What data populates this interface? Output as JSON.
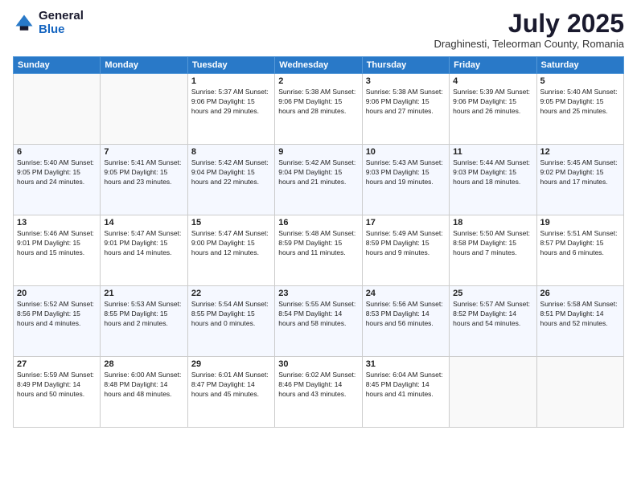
{
  "logo": {
    "general": "General",
    "blue": "Blue"
  },
  "header": {
    "month": "July 2025",
    "location": "Draghinesti, Teleorman County, Romania"
  },
  "weekdays": [
    "Sunday",
    "Monday",
    "Tuesday",
    "Wednesday",
    "Thursday",
    "Friday",
    "Saturday"
  ],
  "weeks": [
    [
      {
        "num": "",
        "detail": ""
      },
      {
        "num": "",
        "detail": ""
      },
      {
        "num": "1",
        "detail": "Sunrise: 5:37 AM\nSunset: 9:06 PM\nDaylight: 15 hours\nand 29 minutes."
      },
      {
        "num": "2",
        "detail": "Sunrise: 5:38 AM\nSunset: 9:06 PM\nDaylight: 15 hours\nand 28 minutes."
      },
      {
        "num": "3",
        "detail": "Sunrise: 5:38 AM\nSunset: 9:06 PM\nDaylight: 15 hours\nand 27 minutes."
      },
      {
        "num": "4",
        "detail": "Sunrise: 5:39 AM\nSunset: 9:06 PM\nDaylight: 15 hours\nand 26 minutes."
      },
      {
        "num": "5",
        "detail": "Sunrise: 5:40 AM\nSunset: 9:05 PM\nDaylight: 15 hours\nand 25 minutes."
      }
    ],
    [
      {
        "num": "6",
        "detail": "Sunrise: 5:40 AM\nSunset: 9:05 PM\nDaylight: 15 hours\nand 24 minutes."
      },
      {
        "num": "7",
        "detail": "Sunrise: 5:41 AM\nSunset: 9:05 PM\nDaylight: 15 hours\nand 23 minutes."
      },
      {
        "num": "8",
        "detail": "Sunrise: 5:42 AM\nSunset: 9:04 PM\nDaylight: 15 hours\nand 22 minutes."
      },
      {
        "num": "9",
        "detail": "Sunrise: 5:42 AM\nSunset: 9:04 PM\nDaylight: 15 hours\nand 21 minutes."
      },
      {
        "num": "10",
        "detail": "Sunrise: 5:43 AM\nSunset: 9:03 PM\nDaylight: 15 hours\nand 19 minutes."
      },
      {
        "num": "11",
        "detail": "Sunrise: 5:44 AM\nSunset: 9:03 PM\nDaylight: 15 hours\nand 18 minutes."
      },
      {
        "num": "12",
        "detail": "Sunrise: 5:45 AM\nSunset: 9:02 PM\nDaylight: 15 hours\nand 17 minutes."
      }
    ],
    [
      {
        "num": "13",
        "detail": "Sunrise: 5:46 AM\nSunset: 9:01 PM\nDaylight: 15 hours\nand 15 minutes."
      },
      {
        "num": "14",
        "detail": "Sunrise: 5:47 AM\nSunset: 9:01 PM\nDaylight: 15 hours\nand 14 minutes."
      },
      {
        "num": "15",
        "detail": "Sunrise: 5:47 AM\nSunset: 9:00 PM\nDaylight: 15 hours\nand 12 minutes."
      },
      {
        "num": "16",
        "detail": "Sunrise: 5:48 AM\nSunset: 8:59 PM\nDaylight: 15 hours\nand 11 minutes."
      },
      {
        "num": "17",
        "detail": "Sunrise: 5:49 AM\nSunset: 8:59 PM\nDaylight: 15 hours\nand 9 minutes."
      },
      {
        "num": "18",
        "detail": "Sunrise: 5:50 AM\nSunset: 8:58 PM\nDaylight: 15 hours\nand 7 minutes."
      },
      {
        "num": "19",
        "detail": "Sunrise: 5:51 AM\nSunset: 8:57 PM\nDaylight: 15 hours\nand 6 minutes."
      }
    ],
    [
      {
        "num": "20",
        "detail": "Sunrise: 5:52 AM\nSunset: 8:56 PM\nDaylight: 15 hours\nand 4 minutes."
      },
      {
        "num": "21",
        "detail": "Sunrise: 5:53 AM\nSunset: 8:55 PM\nDaylight: 15 hours\nand 2 minutes."
      },
      {
        "num": "22",
        "detail": "Sunrise: 5:54 AM\nSunset: 8:55 PM\nDaylight: 15 hours\nand 0 minutes."
      },
      {
        "num": "23",
        "detail": "Sunrise: 5:55 AM\nSunset: 8:54 PM\nDaylight: 14 hours\nand 58 minutes."
      },
      {
        "num": "24",
        "detail": "Sunrise: 5:56 AM\nSunset: 8:53 PM\nDaylight: 14 hours\nand 56 minutes."
      },
      {
        "num": "25",
        "detail": "Sunrise: 5:57 AM\nSunset: 8:52 PM\nDaylight: 14 hours\nand 54 minutes."
      },
      {
        "num": "26",
        "detail": "Sunrise: 5:58 AM\nSunset: 8:51 PM\nDaylight: 14 hours\nand 52 minutes."
      }
    ],
    [
      {
        "num": "27",
        "detail": "Sunrise: 5:59 AM\nSunset: 8:49 PM\nDaylight: 14 hours\nand 50 minutes."
      },
      {
        "num": "28",
        "detail": "Sunrise: 6:00 AM\nSunset: 8:48 PM\nDaylight: 14 hours\nand 48 minutes."
      },
      {
        "num": "29",
        "detail": "Sunrise: 6:01 AM\nSunset: 8:47 PM\nDaylight: 14 hours\nand 45 minutes."
      },
      {
        "num": "30",
        "detail": "Sunrise: 6:02 AM\nSunset: 8:46 PM\nDaylight: 14 hours\nand 43 minutes."
      },
      {
        "num": "31",
        "detail": "Sunrise: 6:04 AM\nSunset: 8:45 PM\nDaylight: 14 hours\nand 41 minutes."
      },
      {
        "num": "",
        "detail": ""
      },
      {
        "num": "",
        "detail": ""
      }
    ]
  ]
}
